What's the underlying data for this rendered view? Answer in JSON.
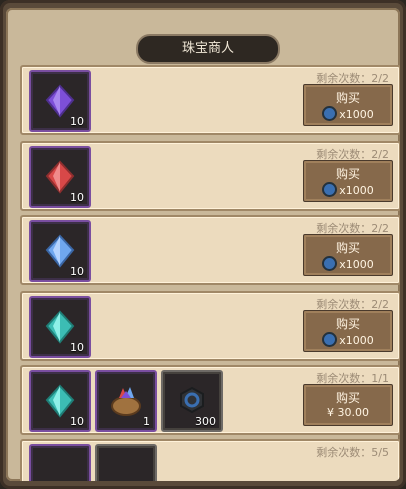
{
  "title": "珠宝商人",
  "colors": {
    "purple_gem": "#7d4fd8",
    "red_gem": "#d84848",
    "blue_gem": "#6fa7ef",
    "teal_gem": "#3cbdb4",
    "coin": "#3a6fb1"
  },
  "rows": [
    {
      "remain": "剩余次数：2/2",
      "items": [
        {
          "icon": "purple-gem-icon",
          "qty": "10"
        }
      ],
      "buy_label": "购买",
      "price": "x1000"
    },
    {
      "remain": "剩余次数：2/2",
      "items": [
        {
          "icon": "red-gem-icon",
          "qty": "10"
        }
      ],
      "buy_label": "购买",
      "price": "x1000"
    },
    {
      "remain": "剩余次数：2/2",
      "items": [
        {
          "icon": "blue-gem-icon",
          "qty": "10"
        }
      ],
      "buy_label": "购买",
      "price": "x1000"
    },
    {
      "remain": "剩余次数：2/2",
      "items": [
        {
          "icon": "teal-gem-icon",
          "qty": "10"
        }
      ],
      "buy_label": "购买",
      "price": "x1000"
    },
    {
      "remain": "剩余次数：1/1",
      "items": [
        {
          "icon": "teal-gem-icon",
          "qty": "10"
        },
        {
          "icon": "gem-bag-icon",
          "qty": "1"
        },
        {
          "icon": "coin-icon",
          "qty": "300"
        }
      ],
      "buy_label": "购买",
      "price": "¥ 30.00"
    },
    {
      "remain": "剩余次数：5/5"
    }
  ]
}
